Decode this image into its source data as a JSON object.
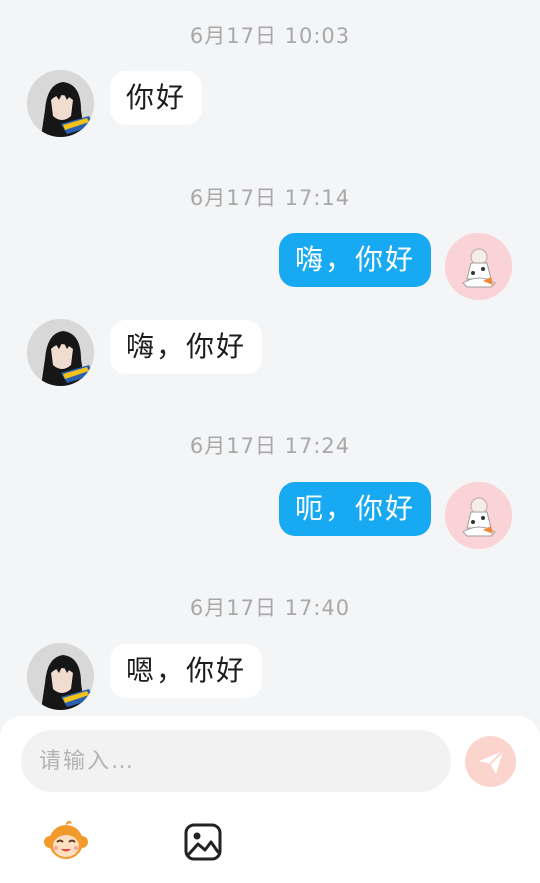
{
  "messages": [
    {
      "timestamp": "6月17日 10:03",
      "sender": "other",
      "text": "你好"
    },
    {
      "timestamp": "6月17日 17:14",
      "sender": "self",
      "text": "嗨，你好"
    },
    {
      "timestamp": null,
      "sender": "other",
      "text": "嗨，你好"
    },
    {
      "timestamp": "6月17日 17:24",
      "sender": "self",
      "text": "呃，你好"
    },
    {
      "timestamp": "6月17日 17:40",
      "sender": "other",
      "text": "嗯，你好"
    }
  ],
  "composer": {
    "placeholder": "请输入…",
    "send_icon": "paper-plane-icon",
    "emoji_icon": "monkey-emoji-icon",
    "image_icon": "image-icon"
  },
  "colors": {
    "background": "#f4f5f7",
    "outgoing_bubble": "#17a9f2",
    "incoming_bubble": "#ffffff",
    "timestamp": "#a8a8a8",
    "send_button": "#fbd4cd"
  }
}
